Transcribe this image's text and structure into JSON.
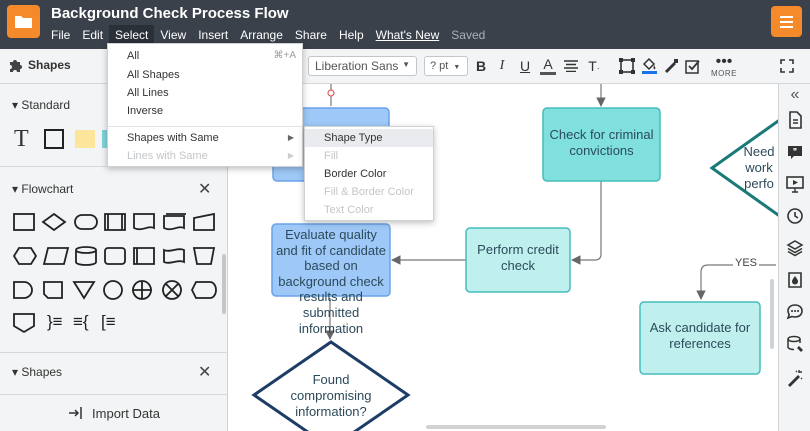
{
  "app": {
    "title": "Background Check Process Flow",
    "menus": [
      "File",
      "Edit",
      "Select",
      "View",
      "Insert",
      "Arrange",
      "Share",
      "Help",
      "What's New",
      "Saved"
    ]
  },
  "toolbar": {
    "panel_title": "Shapes",
    "font": "Liberation Sans",
    "font_size": "? pt",
    "more_label": "MORE"
  },
  "sidebar": {
    "sections": [
      {
        "label": "Standard"
      },
      {
        "label": "Flowchart"
      },
      {
        "label": "Shapes"
      }
    ],
    "standard_text_icon": "T",
    "flowchart_bracket_items": [
      "}≡",
      "≡{",
      "[≡"
    ],
    "import_label": "Import Data"
  },
  "select_menu": {
    "items": [
      {
        "label": "All",
        "shortcut": "⌘+A"
      },
      {
        "label": "All Shapes"
      },
      {
        "label": "All Lines"
      },
      {
        "label": "Inverse"
      },
      {
        "label": "Shapes with Same"
      },
      {
        "label": "Lines with Same"
      }
    ]
  },
  "submenu": {
    "items": [
      {
        "label": "Shape Type"
      },
      {
        "label": "Fill"
      },
      {
        "label": "Border Color"
      },
      {
        "label": "Fill & Border Color"
      },
      {
        "label": "Text Color"
      }
    ]
  },
  "diagram": {
    "nodes": [
      {
        "id": "check-criminal",
        "label": "Check for criminal convictions"
      },
      {
        "id": "perform-credit",
        "label": "Perform credit check"
      },
      {
        "id": "evaluate",
        "label": "Evaluate quality and fit of candidate based on background check results and submitted information"
      },
      {
        "id": "found-compromising",
        "label": "Found compromising information?"
      },
      {
        "id": "ask-references",
        "label": "Ask candidate for references"
      },
      {
        "id": "need-work",
        "label": "Need work perfo"
      }
    ],
    "edge_labels": [
      "YES"
    ]
  },
  "colors": {
    "topbar": "#3a414a",
    "accent": "#f58a2b",
    "node_blue": "#9dc8f7",
    "node_teal": "#7fe0dd",
    "node_light_teal": "#bff0ee",
    "diamond_stroke": "#1d3c66",
    "teal_stroke": "#1a7a78"
  }
}
